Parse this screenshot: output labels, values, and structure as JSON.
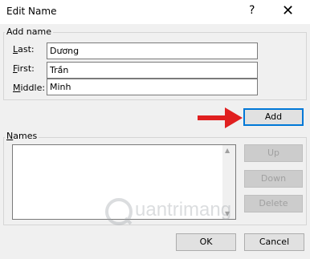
{
  "dialog": {
    "title": "Edit Name",
    "help_glyph": "?",
    "close_glyph": "✕"
  },
  "add_name": {
    "group_label": "Add name",
    "last_label": "Last:",
    "last_value": "Dương",
    "first_label": "First:",
    "first_value": "Trần",
    "middle_label": "Middle:",
    "middle_value": "Minh",
    "add_button": "Add"
  },
  "names": {
    "group_label": "Names",
    "up_button": "Up",
    "down_button": "Down",
    "delete_button": "Delete"
  },
  "footer": {
    "ok_button": "OK",
    "cancel_button": "Cancel"
  },
  "watermark": {
    "text": "uantrimang"
  },
  "colors": {
    "arrow": "#e02020",
    "focus_border": "#0078d7"
  }
}
